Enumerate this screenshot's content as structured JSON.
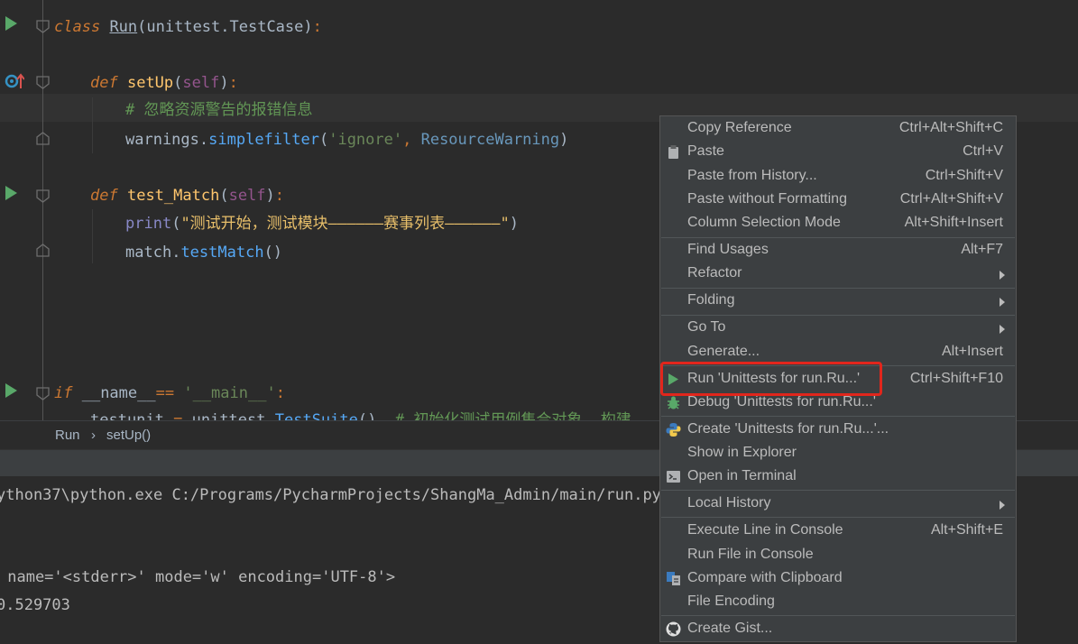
{
  "editor": {
    "lines": [
      {
        "parts": [
          "class",
          " ",
          "Run",
          "(unittest.TestCase)",
          ":"
        ]
      },
      {
        "parts": [
          "def",
          " ",
          "setUp",
          "(",
          "self",
          ")",
          ":"
        ]
      },
      {
        "parts": [
          "# 忽略资源警告的报错信息"
        ]
      },
      {
        "parts": [
          "warnings",
          ".",
          "simplefilter",
          "(",
          "'ignore'",
          ", ",
          "ResourceWarning",
          ")"
        ]
      },
      {
        "parts": [
          "def",
          " ",
          "test_Match",
          "(",
          "self",
          ")",
          ":"
        ]
      },
      {
        "parts": [
          "print",
          "(",
          "\"测试开始，测试模块——————赛事列表——————\"",
          ")"
        ]
      },
      {
        "parts": [
          "match",
          ".",
          "testMatch",
          "()"
        ]
      },
      {
        "parts": [
          "if",
          " __name__",
          "==",
          " ",
          "'__main__'",
          ":"
        ]
      },
      {
        "parts": [
          "testunit",
          " = ",
          "unittest",
          ".",
          "TestSuite",
          "()",
          "  ",
          "# 初始化测试用例集合对象  构建"
        ]
      }
    ]
  },
  "breadcrumb": {
    "class_name": "Run",
    "separator": "›",
    "method": "setUp()"
  },
  "console": {
    "lines": [
      "ython37\\python.exe C:/Programs/PycharmProjects/ShangMa_Admin/main/run.py",
      " name='<stderr>' mode='w' encoding='UTF-8'>",
      "0.529703"
    ]
  },
  "context_menu": {
    "items": [
      {
        "label": "Copy Reference",
        "shortcut": "Ctrl+Alt+Shift+C"
      },
      {
        "label": "Paste",
        "shortcut": "Ctrl+V",
        "icon": "clipboard-icon"
      },
      {
        "label": "Paste from History...",
        "shortcut": "Ctrl+Shift+V"
      },
      {
        "label": "Paste without Formatting",
        "shortcut": "Ctrl+Alt+Shift+V"
      },
      {
        "label": "Column Selection Mode",
        "shortcut": "Alt+Shift+Insert"
      },
      {
        "label": "Find Usages",
        "shortcut": "Alt+F7"
      },
      {
        "label": "Refactor",
        "submenu": true
      },
      {
        "label": "Folding",
        "submenu": true
      },
      {
        "label": "Go To",
        "submenu": true
      },
      {
        "label": "Generate...",
        "shortcut": "Alt+Insert"
      },
      {
        "label": "Run 'Unittests for run.Ru...'",
        "shortcut": "Ctrl+Shift+F10",
        "icon": "run-icon"
      },
      {
        "label": "Debug 'Unittests for run.Ru...'",
        "icon": "debug-icon"
      },
      {
        "label": "Create 'Unittests for run.Ru...'...",
        "icon": "python-icon"
      },
      {
        "label": "Show in Explorer"
      },
      {
        "label": "Open in Terminal",
        "icon": "terminal-icon"
      },
      {
        "label": "Local History",
        "submenu": true
      },
      {
        "label": "Execute Line in Console",
        "shortcut": "Alt+Shift+E"
      },
      {
        "label": "Run File in Console"
      },
      {
        "label": "Compare with Clipboard",
        "icon": "compare-icon"
      },
      {
        "label": "File Encoding"
      },
      {
        "label": "Create Gist...",
        "icon": "github-icon"
      }
    ]
  },
  "colors": {
    "accent_run": "#59a869",
    "highlight": "#e1261c"
  }
}
